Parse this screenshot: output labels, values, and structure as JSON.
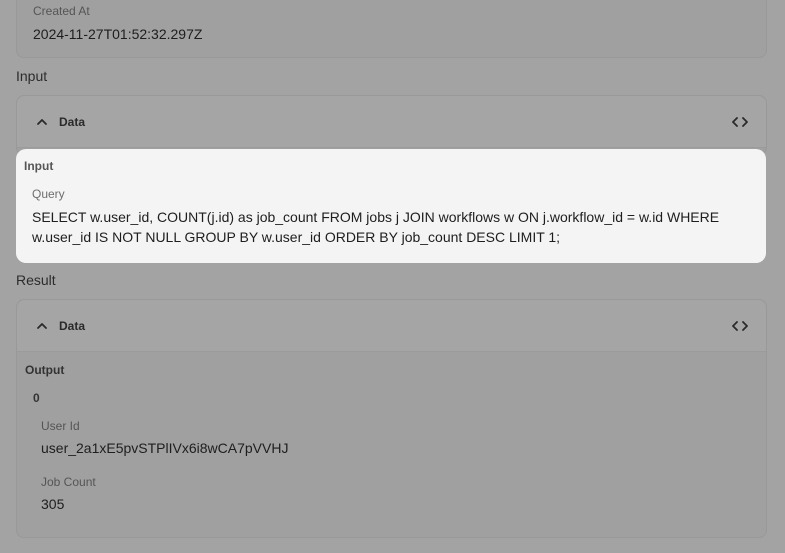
{
  "created_at": {
    "label": "Created At",
    "value": "2024-11-27T01:52:32.297Z"
  },
  "input_section": {
    "title": "Input",
    "data_header": {
      "label": "Data",
      "toggle_icon": "chevron-up-icon",
      "code_icon": "code-icon"
    },
    "panel": {
      "title": "Input",
      "query_label": "Query",
      "query_value": "SELECT w.user_id, COUNT(j.id) as job_count FROM jobs j JOIN workflows w ON j.workflow_id = w.id WHERE w.user_id IS NOT NULL GROUP BY w.user_id ORDER BY job_count DESC LIMIT 1;"
    }
  },
  "result_section": {
    "title": "Result",
    "data_header": {
      "label": "Data",
      "toggle_icon": "chevron-up-icon",
      "code_icon": "code-icon"
    },
    "output": {
      "title": "Output",
      "rows": [
        {
          "index": "0",
          "user_id_label": "User Id",
          "user_id_value": "user_2a1xE5pvSTPlIVx6i8wCA7pVVHJ",
          "job_count_label": "Job Count",
          "job_count_value": "305"
        }
      ]
    }
  }
}
